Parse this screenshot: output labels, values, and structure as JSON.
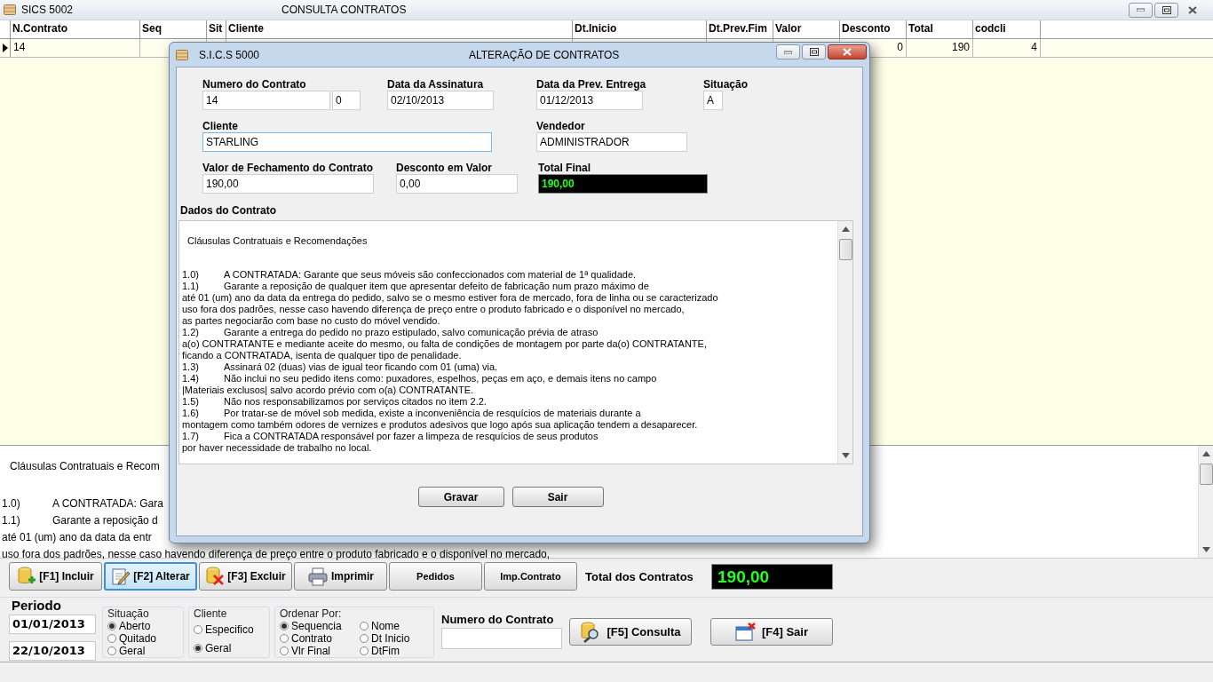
{
  "main_window": {
    "app": "SICS 5002",
    "title": "CONSULTA CONTRATOS"
  },
  "grid": {
    "columns": [
      "N.Contrato",
      "Seq",
      "Sit",
      "Cliente",
      "Dt.Inicio",
      "Dt.Prev.Fim",
      "Valor",
      "Desconto",
      "Total",
      "codcli"
    ],
    "rows": [
      {
        "selected": true,
        "n_contrato": "14",
        "desconto": "0",
        "total": "190",
        "codcli": "4"
      }
    ]
  },
  "memo": {
    "heading": "Cláusulas Contratuais e Recom",
    "lines": [
      {
        "num": "1.0)",
        "text": "A CONTRATADA: Gara"
      },
      {
        "num": "1.1)",
        "text": "Garante a reposição d"
      },
      {
        "text": "até 01 (um) ano da data da entr"
      },
      {
        "text": "uso fora dos padrões, nesse caso havendo diferença de preço entre o produto fabricado e o disponível no mercado,"
      }
    ]
  },
  "toolbar": {
    "buttons": [
      {
        "label": "[F1] Incluir",
        "selected": false
      },
      {
        "label": "[F2] Alterar",
        "selected": true
      },
      {
        "label": "[F3] Excluir",
        "selected": false
      },
      {
        "label": "Imprimir",
        "selected": false
      },
      {
        "label": "Pedidos",
        "selected": false
      },
      {
        "label": "Imp.Contrato",
        "selected": false
      }
    ],
    "total_label": "Total dos Contratos",
    "total_value": "190,00"
  },
  "filters": {
    "periodo": {
      "label": "Periodo",
      "from": "01/01/2013",
      "to": "22/10/2013"
    },
    "groups": [
      {
        "label": "Situação",
        "options": [
          {
            "label": "Aberto",
            "selected": true
          },
          {
            "label": "Quitado",
            "selected": false
          },
          {
            "label": "Geral",
            "selected": false
          }
        ]
      },
      {
        "label": "Cliente",
        "options": [
          {
            "label": "Especifico",
            "selected": false
          },
          {
            "label": "Geral",
            "selected": true
          }
        ]
      },
      {
        "label": "Ordenar Por:",
        "options": [
          {
            "label": "Sequencia",
            "selected": true
          },
          {
            "label": "Nome",
            "selected": false
          },
          {
            "label": "Contrato",
            "selected": false
          },
          {
            "label": "Dt Inicio",
            "selected": false
          },
          {
            "label": "Vlr Final",
            "selected": false
          },
          {
            "label": "DtFim",
            "selected": false
          }
        ]
      }
    ],
    "numero_contrato": {
      "label": "Numero do Contrato"
    },
    "consulta_button": "[F5] Consulta",
    "sair_button": "[F4] Sair"
  },
  "dialog": {
    "app": "S.I.C.S 5000",
    "title": "ALTERAÇÃO DE  CONTRATOS",
    "numero_contrato": {
      "label": "Numero do Contrato",
      "value": "14",
      "sequence": "0"
    },
    "data_assinatura": {
      "label": "Data da Assinatura",
      "value": "02/10/2013"
    },
    "data_prev_entrega": {
      "label": "Data da Prev. Entrega",
      "value": "01/12/2013"
    },
    "situacao": {
      "label": "Situação",
      "value": "A"
    },
    "cliente": {
      "label": "Cliente",
      "value": "STARLING"
    },
    "vendedor": {
      "label": "Vendedor",
      "value": "ADMINISTRADOR"
    },
    "valor_fechamento": {
      "label": "Valor de Fechamento do Contrato",
      "value": "190,00"
    },
    "desconto_valor": {
      "label": "Desconto em Valor",
      "value": "0,00"
    },
    "total_final": {
      "label": "Total Final",
      "value": "190,00"
    },
    "dados_label": "Dados do Contrato",
    "memo": {
      "heading": "Cláusulas Contratuais e Recomendações",
      "lines": [
        {
          "num": "1.0)",
          "text": "A CONTRATADA: Garante que seus móveis são confeccionados com material de 1ª qualidade."
        },
        {
          "num": "1.1)",
          "text": "Garante a reposição de qualquer item que apresentar defeito de fabricação num prazo máximo de"
        },
        {
          "text": "até 01 (um) ano da data da entrega do pedido, salvo se o mesmo estiver fora de mercado, fora de linha ou se caracterizado"
        },
        {
          "text": "uso fora dos padrões, nesse caso havendo diferença de preço entre o produto fabricado e o disponível no mercado,"
        },
        {
          "text": "as partes negociarão com base no custo do móvel vendido."
        },
        {
          "num": "1.2)",
          "text": "Garante a entrega do pedido no prazo estipulado, salvo comunicação prévia de atraso"
        },
        {
          "text": "a(o) CONTRATANTE e mediante aceite do mesmo, ou falta de condições de montagem por parte da(o) CONTRATANTE,"
        },
        {
          "text": "ficando a CONTRATADA, isenta de qualquer tipo de penalidade."
        },
        {
          "num": "1.3)",
          "text": "Assinará 02 (duas) vias de igual teor ficando com 01 (uma) via."
        },
        {
          "num": "1.4)",
          "text": "Não inclui no seu pedido itens como: puxadores, espelhos, peças em aço, e demais itens no campo"
        },
        {
          "text": "|Materiais exclusos| salvo acordo prévio com o(a) CONTRATANTE."
        },
        {
          "num": "1.5)",
          "text": "Não nos responsabilizamos por serviços citados no item 2.2."
        },
        {
          "num": "1.6)",
          "text": "Por tratar-se de móvel sob medida, existe a inconveniência de resquícios de materiais durante a"
        },
        {
          "text": "montagem como também odores de vernizes e produtos adesivos que logo após sua aplicação tendem a desaparecer."
        },
        {
          "num": "1.7)",
          "text": " Fica a CONTRATADA responsável por fazer a limpeza de resquícios de seus produtos"
        },
        {
          "text": "por haver necessidade de trabalho no local."
        }
      ]
    },
    "buttons": [
      "Gravar",
      "Sair"
    ]
  }
}
